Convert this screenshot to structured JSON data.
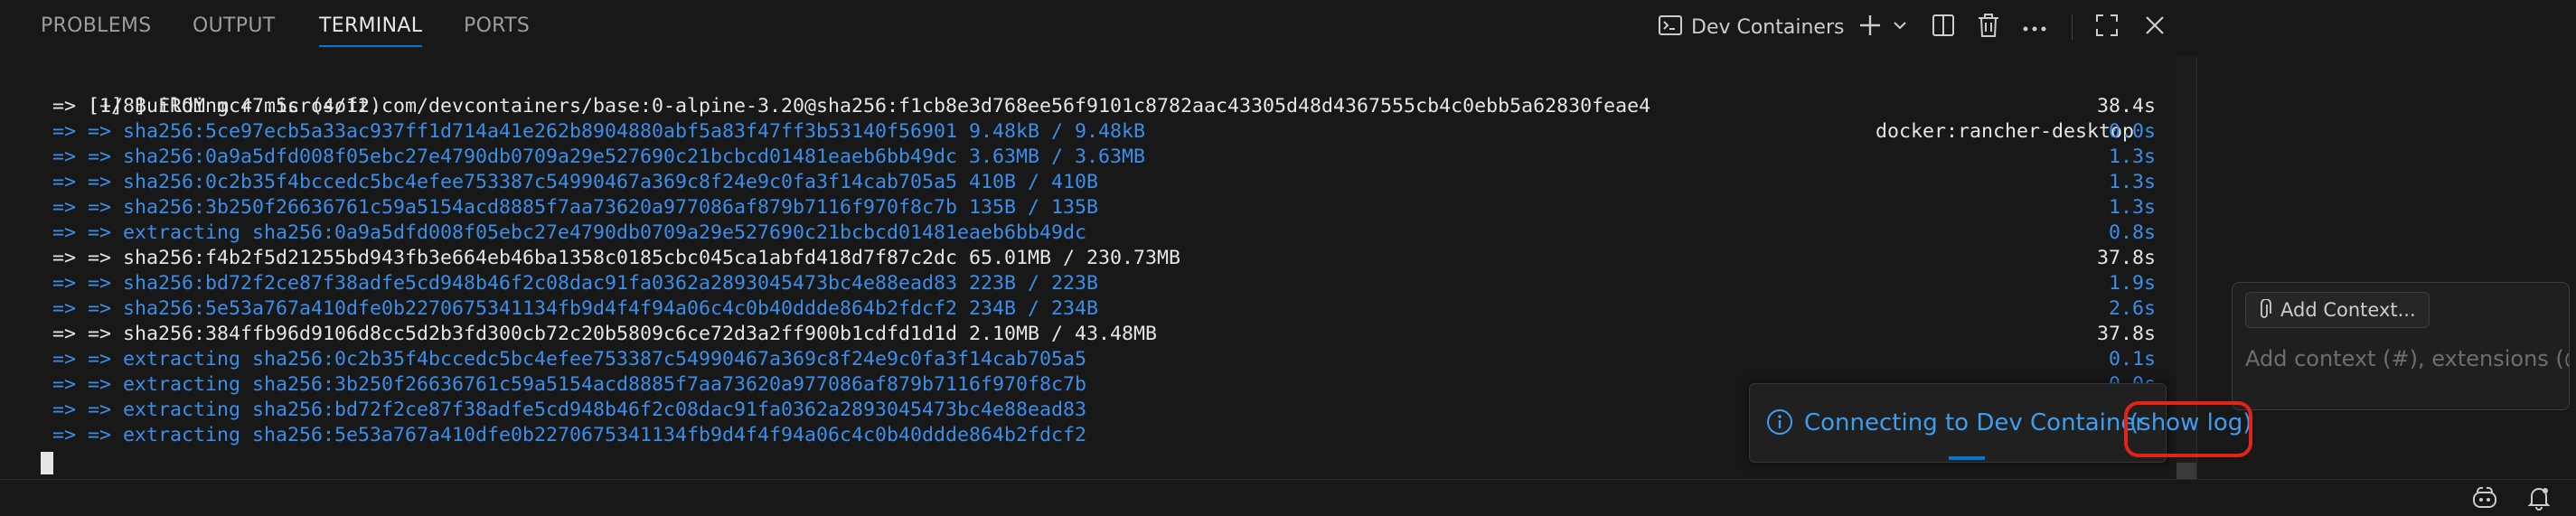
{
  "panel_tabs": [
    {
      "label": "PROBLEMS",
      "active": false
    },
    {
      "label": "OUTPUT",
      "active": false
    },
    {
      "label": "TERMINAL",
      "active": true
    },
    {
      "label": "PORTS",
      "active": false
    }
  ],
  "toolbar": {
    "terminal_profile_label": "Dev Containers",
    "icons": [
      "terminal-icon",
      "plus-icon",
      "chevron-down-icon",
      "split-icon",
      "trash-icon",
      "more-icon",
      "maximize-icon",
      "close-icon"
    ]
  },
  "terminal": {
    "header": {
      "text": "[+] Building 47.5s (4/12)",
      "context": "docker:rancher-desktop"
    },
    "lines": [
      {
        "text": " => [1/8] FROM mcr.microsoft.com/devcontainers/base:0-alpine-3.20@sha256:f1cb8e3d768ee56f9101c8782aac43305d48d4367555cb4c0ebb5a62830feae4",
        "time": "38.4s",
        "color": "white"
      },
      {
        "text": " => => sha256:5ce97ecb5a33ac937ff1d714a41e262b8904880abf5a83f47ff3b53140f56901 9.48kB / 9.48kB",
        "time": "0.0s",
        "color": "blue"
      },
      {
        "text": " => => sha256:0a9a5dfd008f05ebc27e4790db0709a29e527690c21bcbcd01481eaeb6bb49dc 3.63MB / 3.63MB",
        "time": "1.3s",
        "color": "blue"
      },
      {
        "text": " => => sha256:0c2b35f4bccedc5bc4efee753387c54990467a369c8f24e9c0fa3f14cab705a5 410B / 410B",
        "time": "1.3s",
        "color": "blue"
      },
      {
        "text": " => => sha256:3b250f26636761c59a5154acd8885f7aa73620a977086af879b7116f970f8c7b 135B / 135B",
        "time": "1.3s",
        "color": "blue"
      },
      {
        "text": " => => extracting sha256:0a9a5dfd008f05ebc27e4790db0709a29e527690c21bcbcd01481eaeb6bb49dc",
        "time": "0.8s",
        "color": "blue"
      },
      {
        "text": " => => sha256:f4b2f5d21255bd943fb3e664eb46ba1358c0185cbc045ca1abfd418d7f87c2dc 65.01MB / 230.73MB",
        "time": "37.8s",
        "color": "white"
      },
      {
        "text": " => => sha256:bd72f2ce87f38adfe5cd948b46f2c08dac91fa0362a2893045473bc4e88ead83 223B / 223B",
        "time": "1.9s",
        "color": "blue"
      },
      {
        "text": " => => sha256:5e53a767a410dfe0b2270675341134fb9d4f4f94a06c4c0b40ddde864b2fdcf2 234B / 234B",
        "time": "2.6s",
        "color": "blue"
      },
      {
        "text": " => => sha256:384ffb96d9106d8cc5d2b3fd300cb72c20b5809c6ce72d3a2ff900b1cdfd1d1d 2.10MB / 43.48MB",
        "time": "37.8s",
        "color": "white"
      },
      {
        "text": " => => extracting sha256:0c2b35f4bccedc5bc4efee753387c54990467a369c8f24e9c0fa3f14cab705a5",
        "time": "0.1s",
        "color": "blue"
      },
      {
        "text": " => => extracting sha256:3b250f26636761c59a5154acd8885f7aa73620a977086af879b7116f970f8c7b",
        "time": "0.0s",
        "color": "blue"
      },
      {
        "text": " => => extracting sha256:bd72f2ce87f38adfe5cd948b46f2c08dac91fa0362a2893045473bc4e88ead83",
        "time": "",
        "color": "blue"
      },
      {
        "text": " => => extracting sha256:5e53a767a410dfe0b2270675341134fb9d4f4f94a06c4c0b40ddde864b2fdcf2",
        "time": "",
        "color": "blue"
      }
    ]
  },
  "chat": {
    "add_context_label": "Add Context...",
    "input_placeholder": "Add context (#), extensions (@), commands (/)"
  },
  "notification": {
    "message": "Connecting to Dev Container",
    "link": "(show log)"
  },
  "colors": {
    "accent": "#0078d4",
    "terminal_blue": "#3b8eea",
    "terminal_white": "#e5e5e5",
    "highlight_red": "#e2231a",
    "background": "#181818"
  }
}
